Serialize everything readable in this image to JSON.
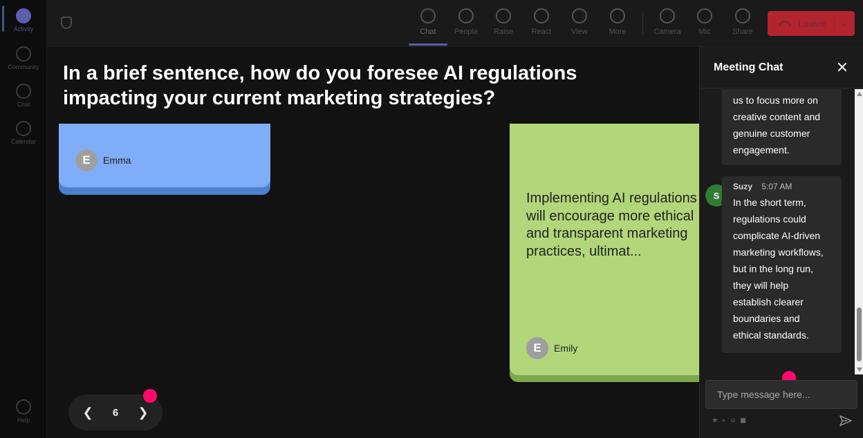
{
  "rail": {
    "items": [
      {
        "label": "Activity",
        "icon": "bell-icon"
      },
      {
        "label": "Community",
        "icon": "community-icon"
      },
      {
        "label": "Chat",
        "icon": "chat-icon"
      },
      {
        "label": "Calendar",
        "icon": "calendar-icon"
      },
      {
        "label": "Help",
        "icon": "help-icon"
      }
    ]
  },
  "toolbar": {
    "chat": "Chat",
    "people": "People",
    "raise": "Raise",
    "react": "React",
    "view": "View",
    "more": "More",
    "camera": "Camera",
    "mic": "Mic",
    "share": "Share",
    "leave": "Leave",
    "leave_color": "#b3242e"
  },
  "stage": {
    "question": "In a brief sentence, how do you foresee AI regulations impacting your current marketing strategies?",
    "cards": [
      {
        "author_initial": "E",
        "author": "Emma",
        "color": "#7fadf7"
      },
      {
        "author_initial": "E",
        "author": "Emily",
        "color": "#b2d67a",
        "lines": [
          "Implementing AI regulations",
          "will encourage more ethical",
          "and transparent marketing",
          "practices, ultimat..."
        ]
      }
    ],
    "pager": {
      "page": "6"
    }
  },
  "chat": {
    "title": "Meeting Chat",
    "messages": [
      {
        "lines": [
          "us to focus more on",
          "creative content and",
          "genuine customer",
          "engagement."
        ]
      },
      {
        "avatar": "S",
        "author": "Suzy",
        "time": "5:07 AM",
        "lines": [
          "In the short term,",
          "regulations could",
          "complicate AI-driven",
          "marketing workflows,",
          "but in the long run,",
          "they will help",
          "establish clearer",
          "boundaries and",
          "ethical standards."
        ]
      }
    ],
    "input_placeholder": "Type message here..."
  }
}
